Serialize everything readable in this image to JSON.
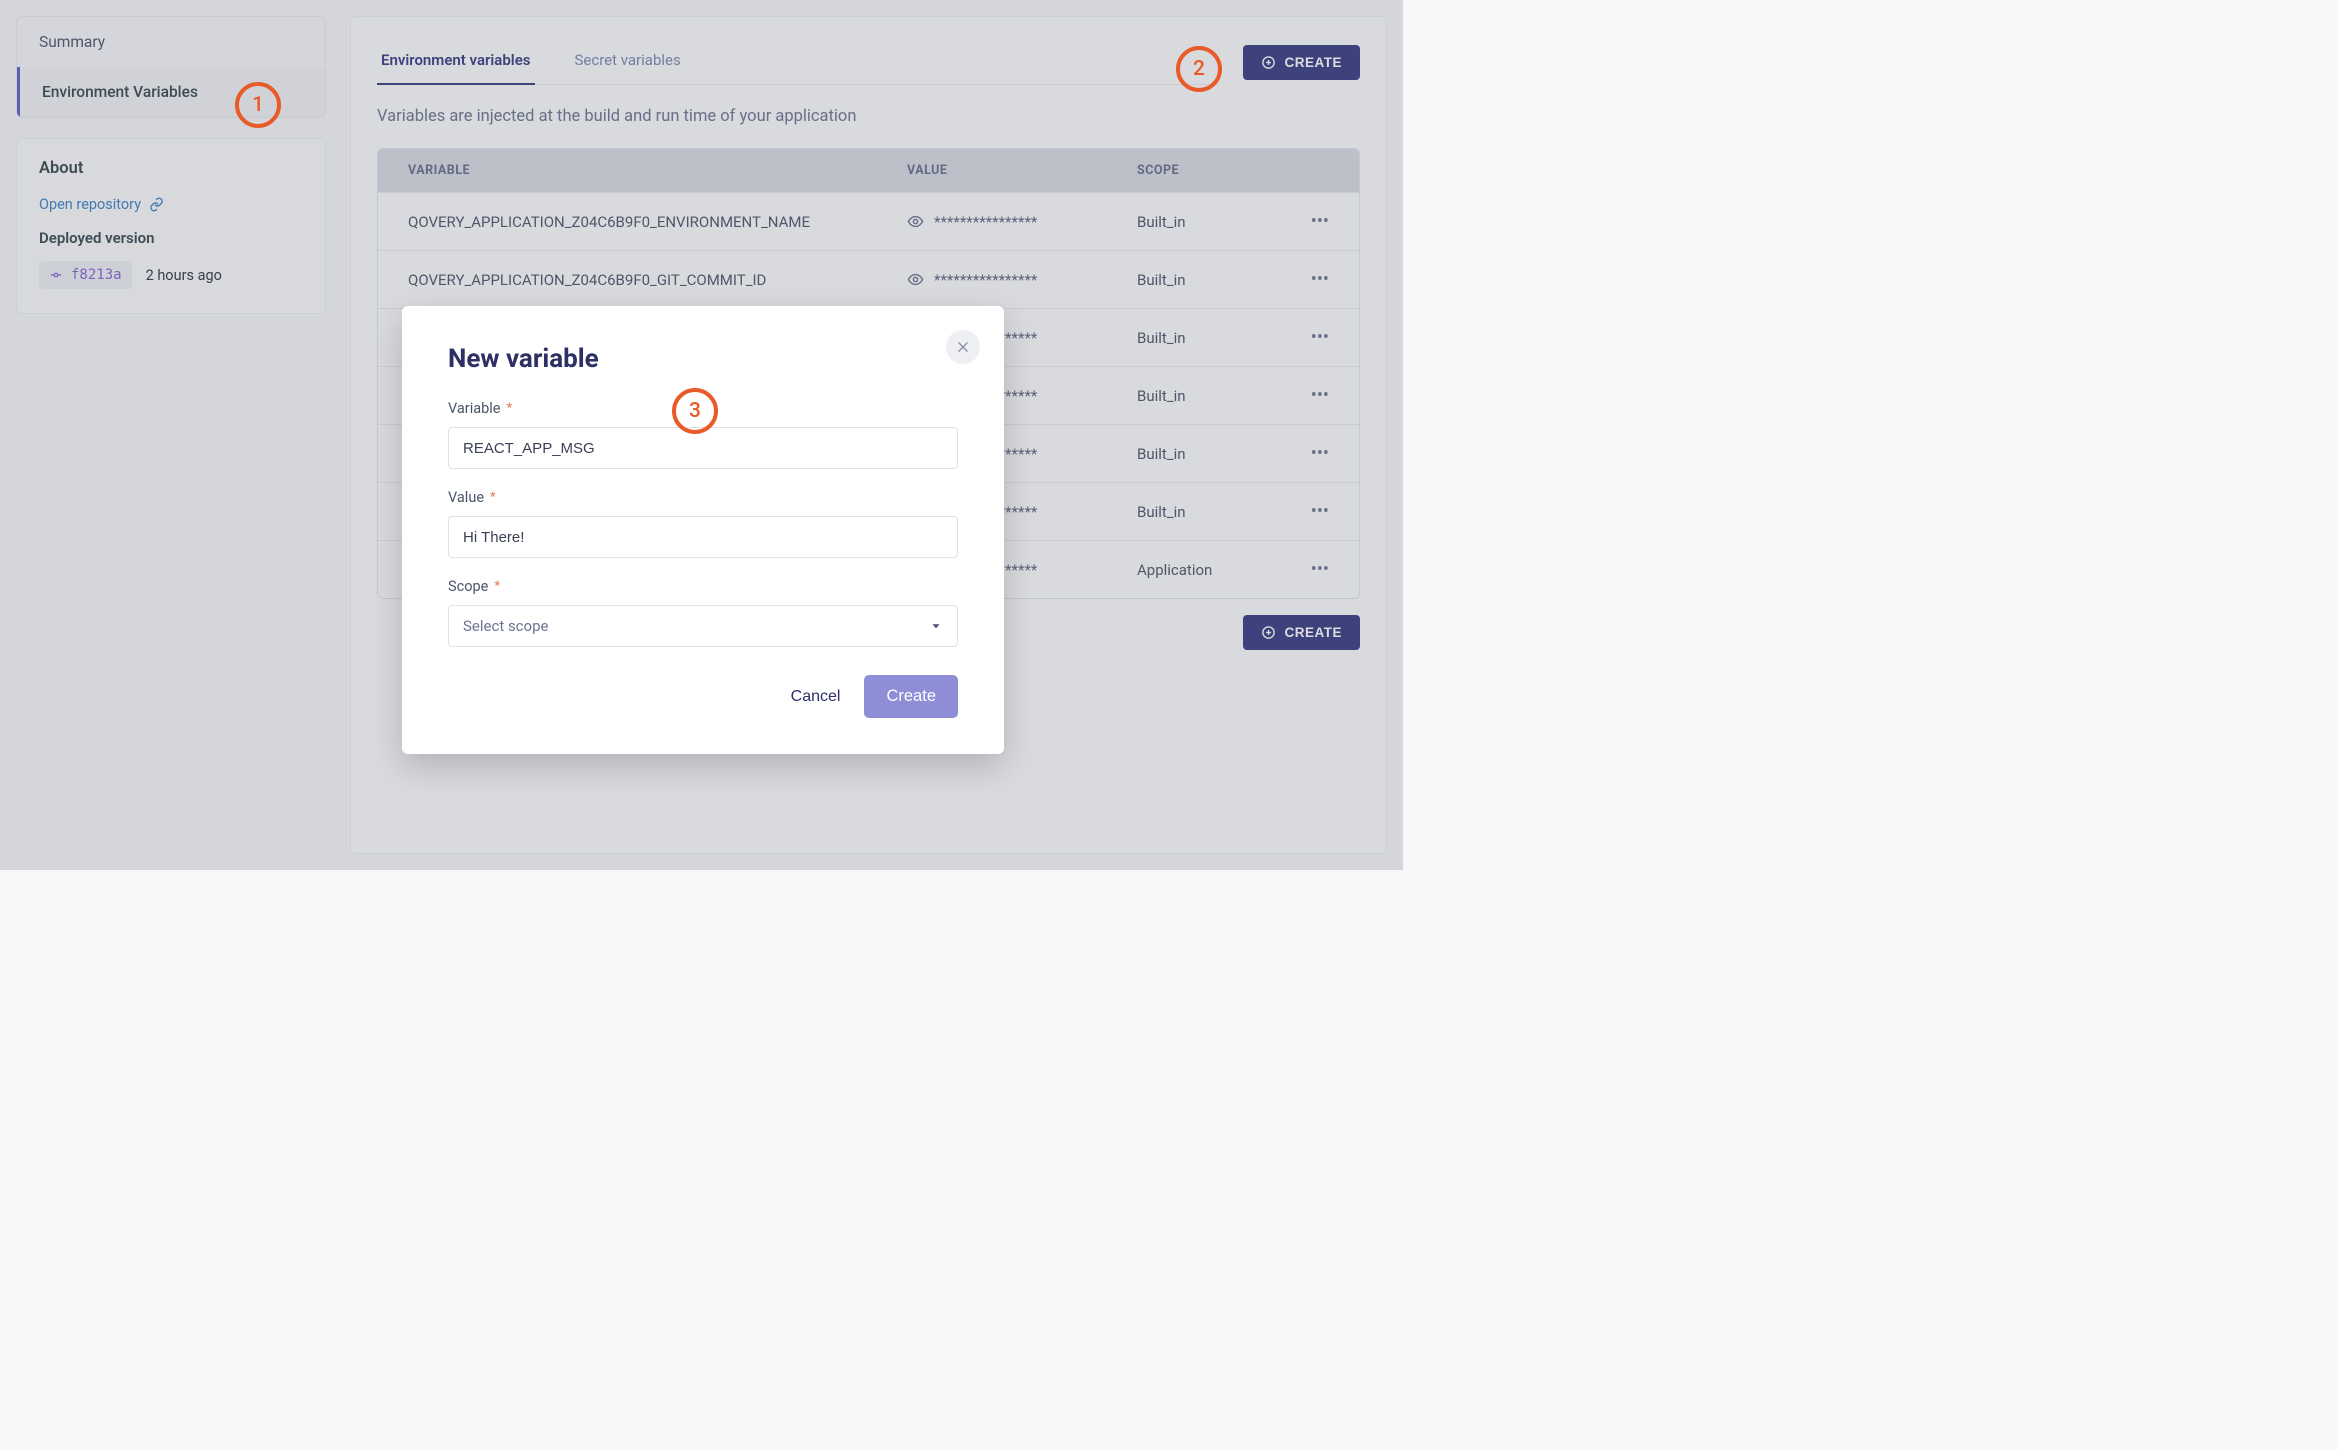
{
  "sidebar": {
    "nav": [
      {
        "label": "Summary"
      },
      {
        "label": "Environment Variables"
      }
    ],
    "about": {
      "title": "About",
      "repo_link": "Open repository",
      "deployed_title": "Deployed version",
      "commit_hash": "f8213a",
      "commit_time": "2 hours ago"
    }
  },
  "main": {
    "tabs": [
      {
        "label": "Environment variables"
      },
      {
        "label": "Secret variables"
      }
    ],
    "create_button": "Create",
    "subtitle": "Variables are injected at the build and run time of your application",
    "headers": {
      "variable": "VARIABLE",
      "value": "VALUE",
      "scope": "SCOPE"
    },
    "masked_value": "****************",
    "rows": [
      {
        "name": "QOVERY_APPLICATION_Z04C6B9F0_ENVIRONMENT_NAME",
        "scope": "Built_in"
      },
      {
        "name": "QOVERY_APPLICATION_Z04C6B9F0_GIT_COMMIT_ID",
        "scope": "Built_in"
      },
      {
        "name": "",
        "scope": "Built_in"
      },
      {
        "name": "",
        "scope": "Built_in"
      },
      {
        "name": "",
        "scope": "Built_in"
      },
      {
        "name": "",
        "scope": "Built_in"
      },
      {
        "name": "",
        "scope": "Application"
      }
    ]
  },
  "modal": {
    "title": "New variable",
    "fields": {
      "variable": {
        "label": "Variable",
        "value": "REACT_APP_MSG"
      },
      "value": {
        "label": "Value",
        "value": "Hi There!"
      },
      "scope": {
        "label": "Scope",
        "placeholder": "Select scope"
      }
    },
    "cancel": "Cancel",
    "submit": "Create"
  },
  "annotations": {
    "a1": "1",
    "a2": "2",
    "a3": "3"
  }
}
